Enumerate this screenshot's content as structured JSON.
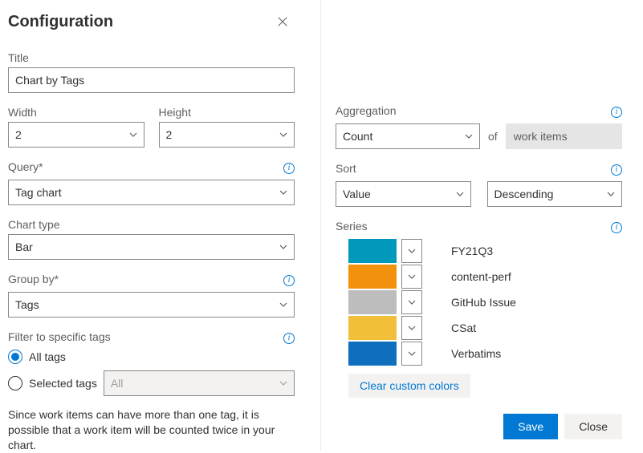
{
  "header": {
    "title": "Configuration"
  },
  "left": {
    "title_label": "Title",
    "title_value": "Chart by Tags",
    "width_label": "Width",
    "width_value": "2",
    "height_label": "Height",
    "height_value": "2",
    "query_label": "Query",
    "query_value": "Tag chart",
    "chart_type_label": "Chart type",
    "chart_type_value": "Bar",
    "group_by_label": "Group by",
    "group_by_value": "Tags",
    "filter_label": "Filter to specific tags",
    "radio_all": "All tags",
    "radio_selected": "Selected tags",
    "selected_tags_value": "All",
    "hint": "Since work items can have more than one tag, it is possible that a work item will be counted twice in your chart."
  },
  "right": {
    "aggregation_label": "Aggregation",
    "aggregation_value": "Count",
    "aggregation_of": "of",
    "aggregation_target": "work items",
    "sort_label": "Sort",
    "sort_field_value": "Value",
    "sort_dir_value": "Descending",
    "series_label": "Series",
    "series": [
      {
        "label": "FY21Q3",
        "color": "#0099bc"
      },
      {
        "label": "content-perf",
        "color": "#f2920c"
      },
      {
        "label": "GitHub Issue",
        "color": "#bdbdbd"
      },
      {
        "label": "CSat",
        "color": "#f2bf3b"
      },
      {
        "label": "Verbatims",
        "color": "#106ebe"
      }
    ],
    "clear_colors_label": "Clear custom colors"
  },
  "footer": {
    "save": "Save",
    "close": "Close"
  }
}
